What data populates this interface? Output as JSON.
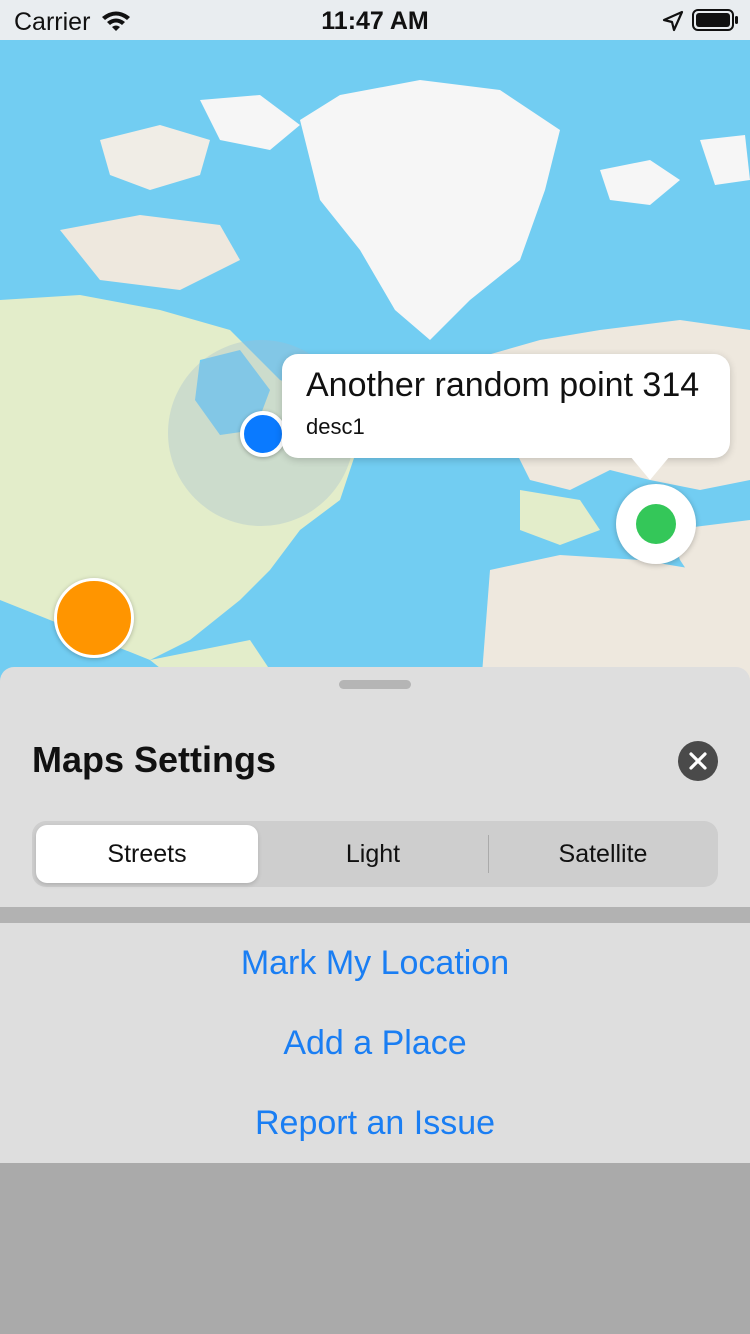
{
  "status_bar": {
    "carrier": "Carrier",
    "time": "11:47 AM"
  },
  "map": {
    "callout": {
      "title": "Another random point 314",
      "subtitle": "desc1"
    },
    "colors": {
      "water": "#72cdf2",
      "land": "#eee8de",
      "vegetation": "#e3edca",
      "ice": "#f6f6f6",
      "user_location": "#0a7aff",
      "place_pin": "#34c759",
      "action_button": "#ff9500"
    }
  },
  "sheet": {
    "title": "Maps Settings",
    "map_style_segments": [
      "Streets",
      "Light",
      "Satellite"
    ],
    "selected_segment": "Streets"
  },
  "actions": {
    "mark_location": "Mark My Location",
    "add_place": "Add a Place",
    "report_issue": "Report an Issue",
    "color": "#1a7ef3"
  }
}
